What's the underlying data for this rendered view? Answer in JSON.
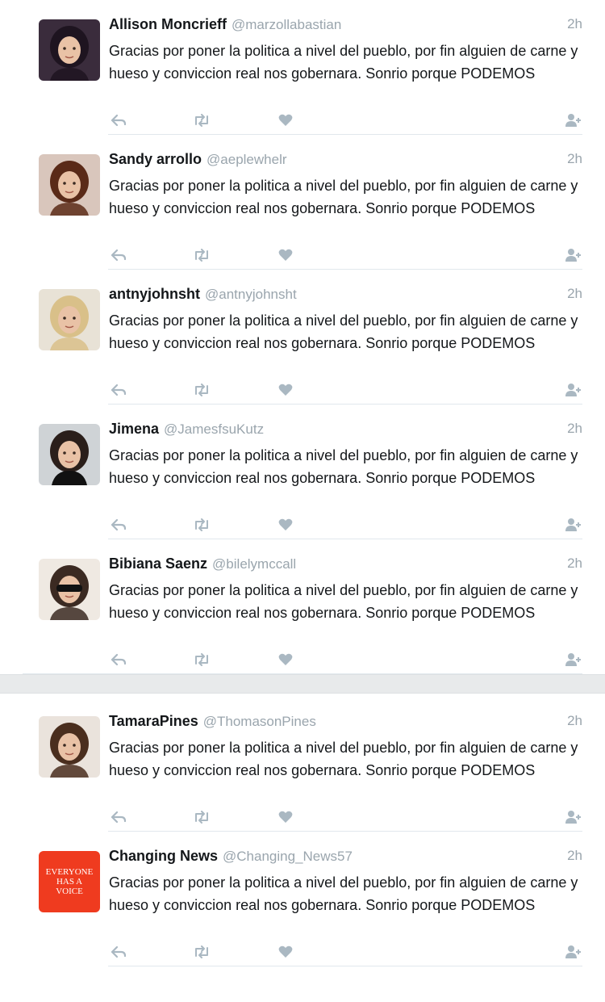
{
  "tweets_group_1": [
    {
      "name": "Allison Moncrieff",
      "handle": "@marzollabastian",
      "time": "2h",
      "text": "Gracias por poner la politica a nivel del pueblo, por fin alguien de carne y hueso y conviccion real nos gobernara. Sonrio porque PODEMOS",
      "avatar": "dark-portrait"
    },
    {
      "name": "Sandy arrollo",
      "handle": "@aeplewhelr",
      "time": "2h",
      "text": "Gracias por poner la politica a nivel del pueblo, por fin alguien de carne y hueso y conviccion real nos gobernara. Sonrio porque PODEMOS",
      "avatar": "woman-brown-hair"
    },
    {
      "name": "antnyjohnsht",
      "handle": "@antnyjohnsht",
      "time": "2h",
      "text": "Gracias por poner la politica a nivel del pueblo, por fin alguien de carne y hueso y conviccion real nos gobernara. Sonrio porque PODEMOS",
      "avatar": "woman-blonde-hair"
    },
    {
      "name": "Jimena",
      "handle": "@JamesfsuKutz",
      "time": "2h",
      "text": "Gracias por poner la politica a nivel del pueblo, por fin alguien de carne y hueso y conviccion real nos gobernara. Sonrio porque PODEMOS",
      "avatar": "woman-black-dress"
    },
    {
      "name": "Bibiana Saenz",
      "handle": "@bilelymccall",
      "time": "2h",
      "text": "Gracias por poner la politica a nivel del pueblo, por fin alguien de carne y hueso y conviccion real nos gobernara. Sonrio porque PODEMOS",
      "avatar": "woman-sunglasses"
    }
  ],
  "tweets_group_2": [
    {
      "name": "TamaraPines",
      "handle": "@ThomasonPines",
      "time": "2h",
      "text": "Gracias por poner la politica a nivel del pueblo, por fin alguien de carne y hueso y conviccion real nos gobernara. Sonrio porque PODEMOS",
      "avatar": "woman-long-hair"
    },
    {
      "name": "Changing News",
      "handle": "@Changing_News57",
      "time": "2h",
      "text": "Gracias por poner la politica a nivel del pueblo, por fin alguien de carne y hueso y conviccion real nos gobernara. Sonrio porque PODEMOS",
      "avatar": "red-logo",
      "avatar_text": "Everyone Has A Voice"
    }
  ],
  "colors": {
    "name": "#14171a",
    "meta": "#9aa5ad",
    "action_icon": "#aab8c2",
    "divider": "#e1e8ed",
    "logo_red": "#ef3b1f"
  },
  "icons": [
    "reply-icon",
    "retweet-icon",
    "like-icon",
    "follow-icon"
  ]
}
